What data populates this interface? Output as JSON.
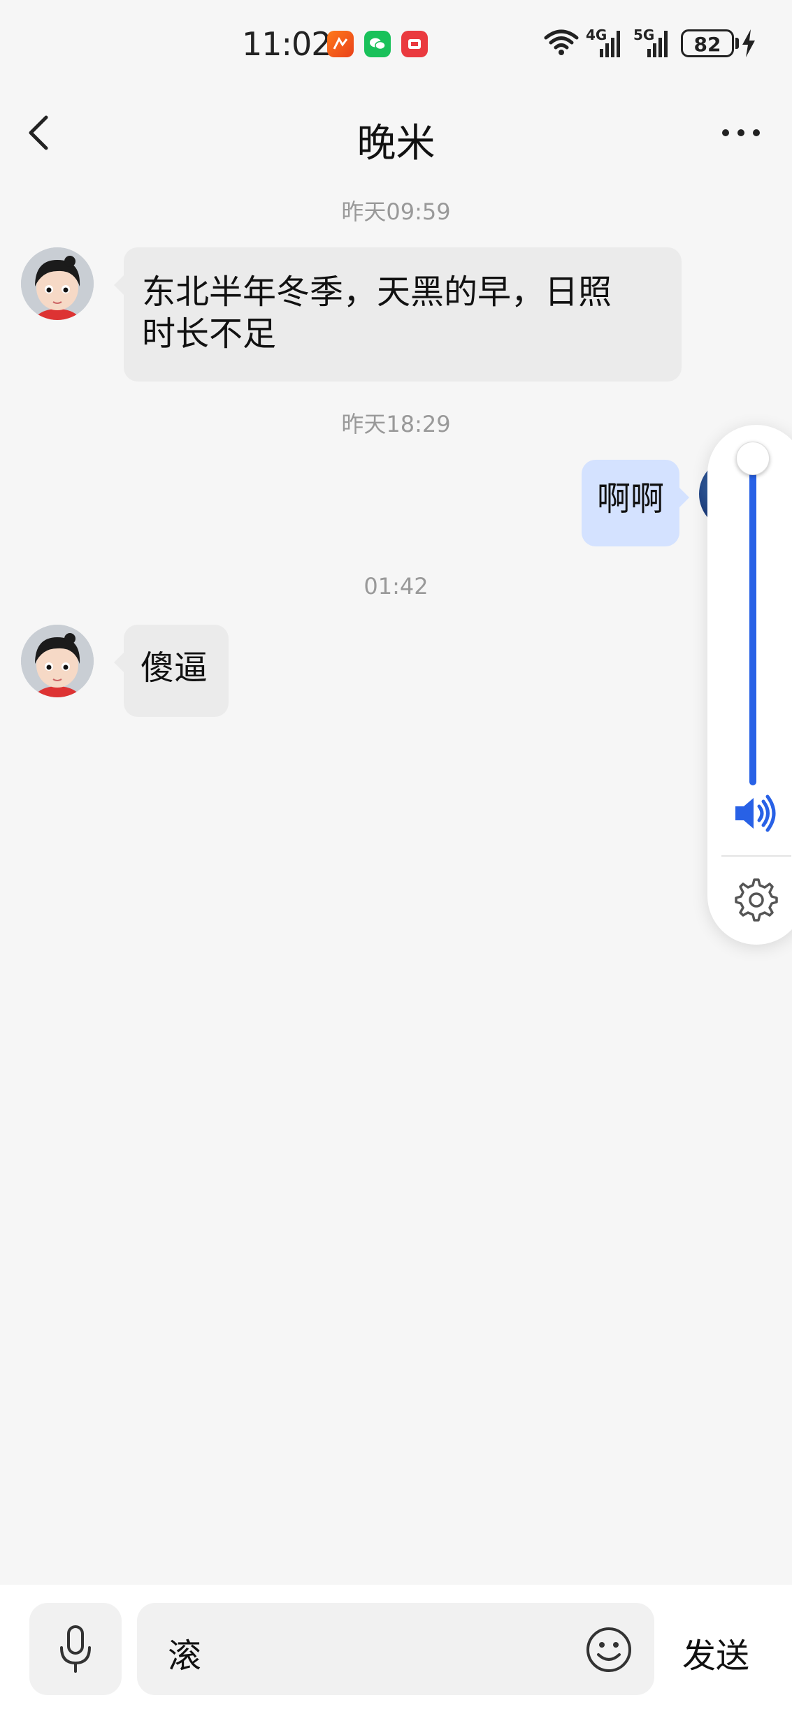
{
  "status_bar": {
    "time": "11:02",
    "battery": "82",
    "network_1": "4G",
    "network_2": "5G"
  },
  "header": {
    "title": "晚米"
  },
  "messages": [
    {
      "timestamp": "昨天09:59",
      "direction": "incoming",
      "text_line1": "东北半年冬季，天黑的早，日照",
      "text_line2": "时长不足"
    },
    {
      "timestamp": "昨天18:29",
      "direction": "outgoing",
      "text": "啊啊"
    },
    {
      "timestamp": "01:42",
      "direction": "incoming",
      "text": "傻逼"
    }
  ],
  "volume_overlay": {
    "level": 1.0,
    "accent_color": "#2861e6",
    "icons": [
      "speaker-icon",
      "gear-icon"
    ]
  },
  "input_bar": {
    "value": "滚",
    "send_label": "发送",
    "icons": [
      "mic-icon",
      "emoji-icon"
    ]
  }
}
